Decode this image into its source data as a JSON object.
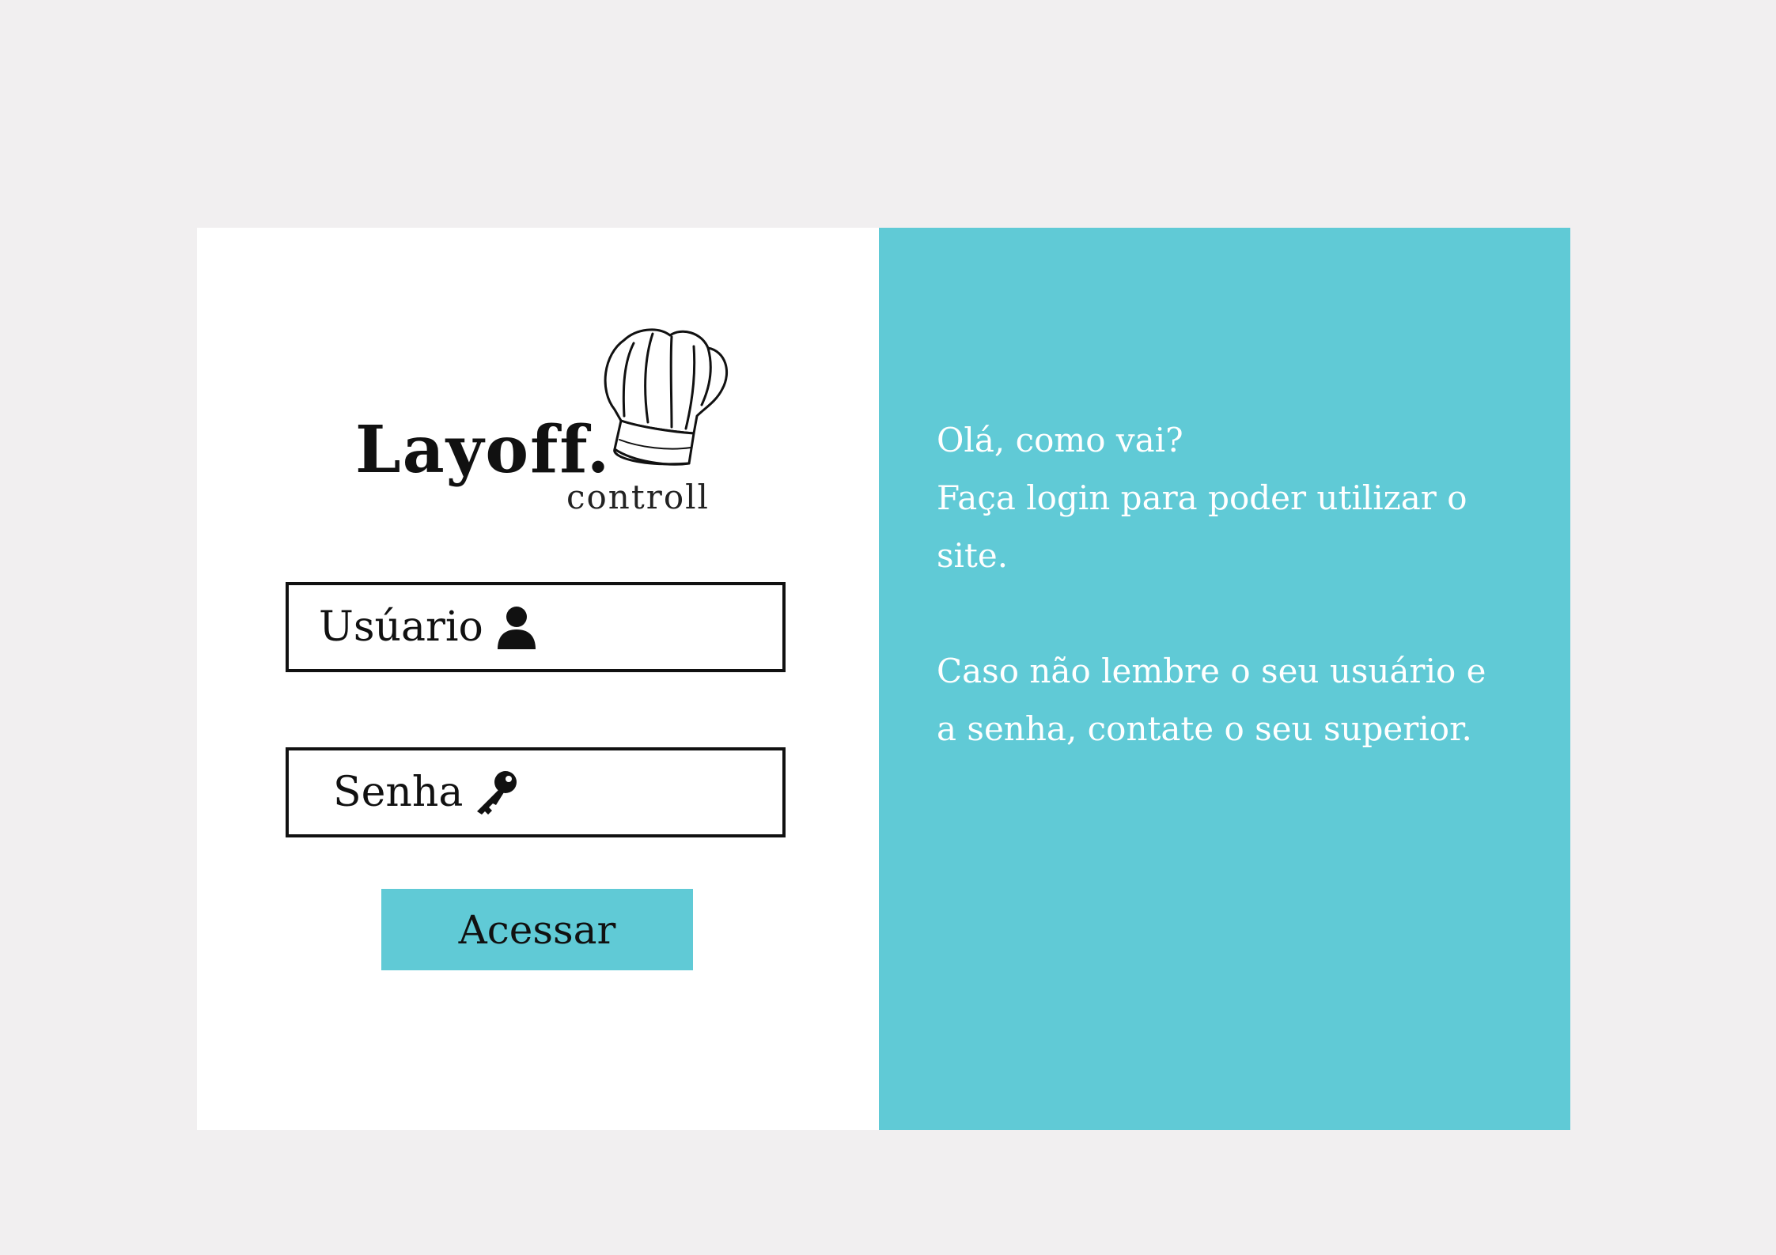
{
  "logo": {
    "name": "Layoff.",
    "sub": "controll",
    "icon": "chef-hat-icon"
  },
  "login": {
    "username_label": "Usúario",
    "username_icon": "user-icon",
    "password_label": "Senha",
    "password_icon": "key-icon",
    "submit_label": "Acessar"
  },
  "info": {
    "greeting": "Olá, como vai?",
    "line1": "Faça login para poder utilizar o site.",
    "line2": "Caso não lembre o seu usuário e a senha, contate o seu superior."
  },
  "colors": {
    "accent": "#60cad6",
    "background": "#f1eff0",
    "panel": "#ffffff",
    "text_dark": "#111111",
    "text_light": "#ffffff"
  }
}
